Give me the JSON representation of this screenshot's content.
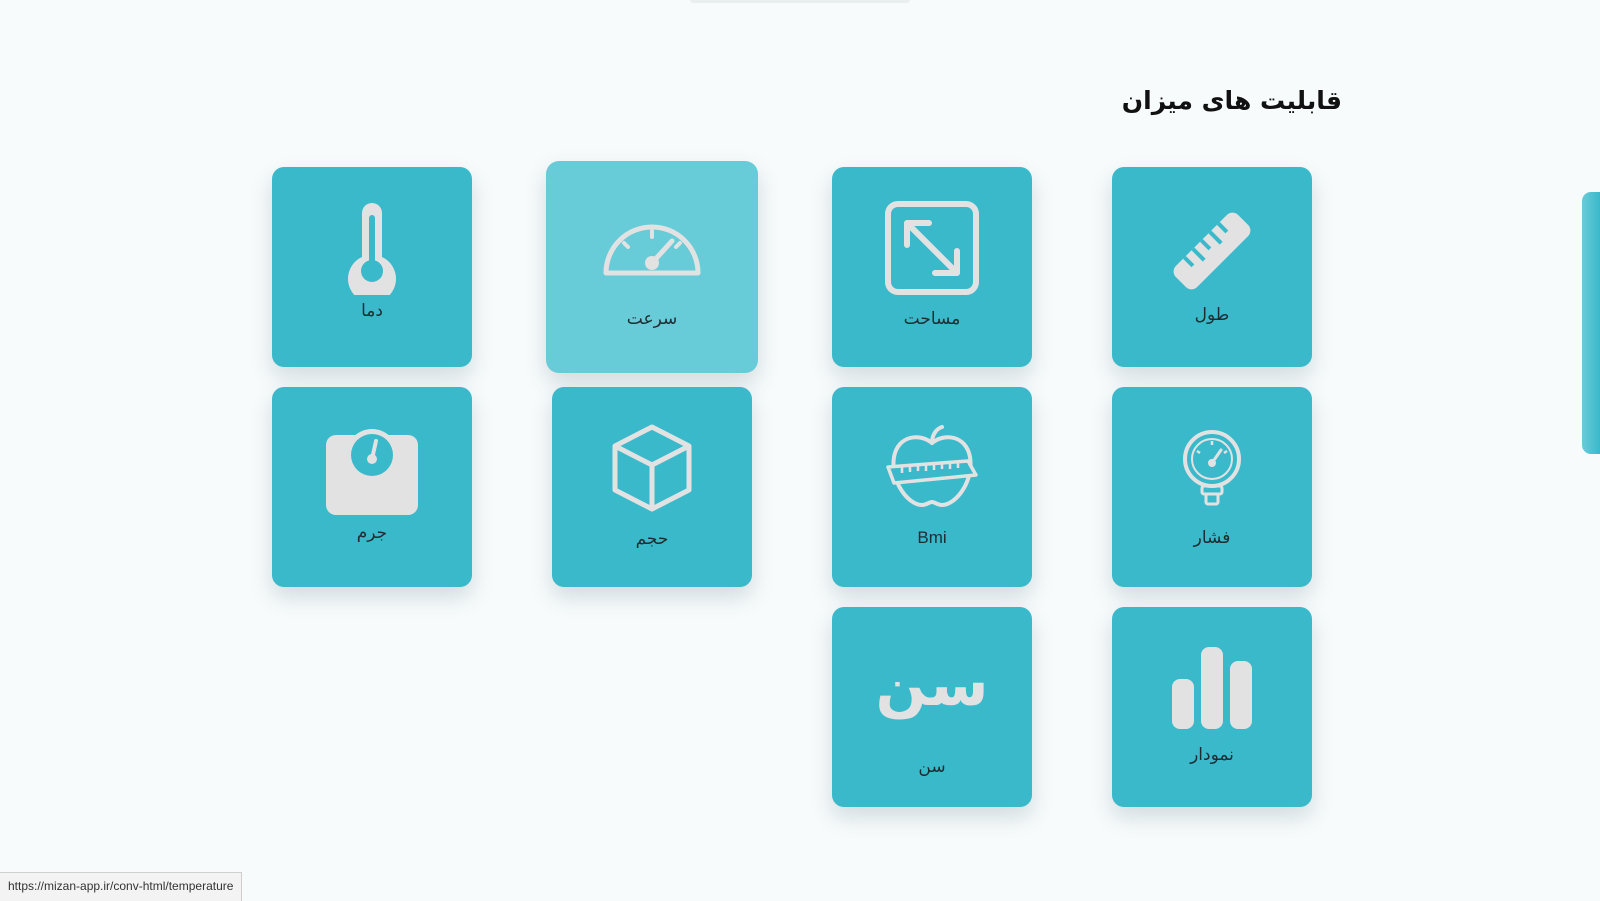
{
  "section": {
    "title": "قابلیت های میزان"
  },
  "tiles": {
    "length": {
      "label": "طول",
      "icon": "ruler-icon"
    },
    "area": {
      "label": "مساحت",
      "icon": "resize-arrow-icon"
    },
    "speed": {
      "label": "سرعت",
      "icon": "speedometer-icon"
    },
    "temperature": {
      "label": "دما",
      "icon": "thermometer-icon"
    },
    "pressure": {
      "label": "فشار",
      "icon": "pressure-gauge-icon"
    },
    "bmi": {
      "label": "Bmi",
      "icon": "apple-tape-measure-icon"
    },
    "volume": {
      "label": "حجم",
      "icon": "cube-icon"
    },
    "mass": {
      "label": "جرم",
      "icon": "weighing-scale-icon"
    },
    "chart": {
      "label": "نمودار",
      "icon": "bar-chart-icon"
    },
    "age": {
      "label": "سن",
      "icon": "age-text-icon",
      "icon_text": "سن"
    }
  },
  "colors": {
    "tile": "#3ab9cb",
    "tile_hover": "#67ccd8",
    "icon": "#e2e2e2",
    "background": "#f7fbfc"
  },
  "status_bar": {
    "url": "https://mizan-app.ir/conv-html/temperature"
  }
}
